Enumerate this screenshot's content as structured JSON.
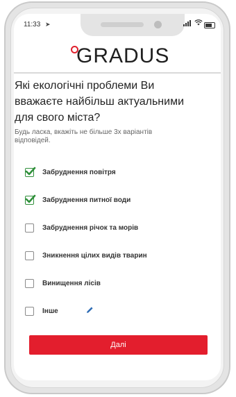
{
  "status": {
    "time": "11:33",
    "location_icon": "location-arrow-icon",
    "signal_icon": "signal-icon",
    "wifi_icon": "wifi-icon",
    "battery_icon": "battery-icon"
  },
  "brand": {
    "logo_text": "GRADUS",
    "accent_color": "#e31e2d"
  },
  "survey": {
    "question": "Які екологічні проблеми Ви вважаєте найбільш актуальними для свого міста?",
    "hint": "Будь ласка, вкажіть не більше 3х варіантів відповідей.",
    "options": [
      {
        "label": "Забруднення повітря",
        "checked": true
      },
      {
        "label": "Забруднення питної води",
        "checked": true
      },
      {
        "label": "Забруднення річок та морів",
        "checked": false
      },
      {
        "label": "Зникнення цілих видів тварин",
        "checked": false
      },
      {
        "label": "Винищення лісів",
        "checked": false
      },
      {
        "label": "Інше",
        "checked": false
      }
    ],
    "next_button": "Далі"
  }
}
